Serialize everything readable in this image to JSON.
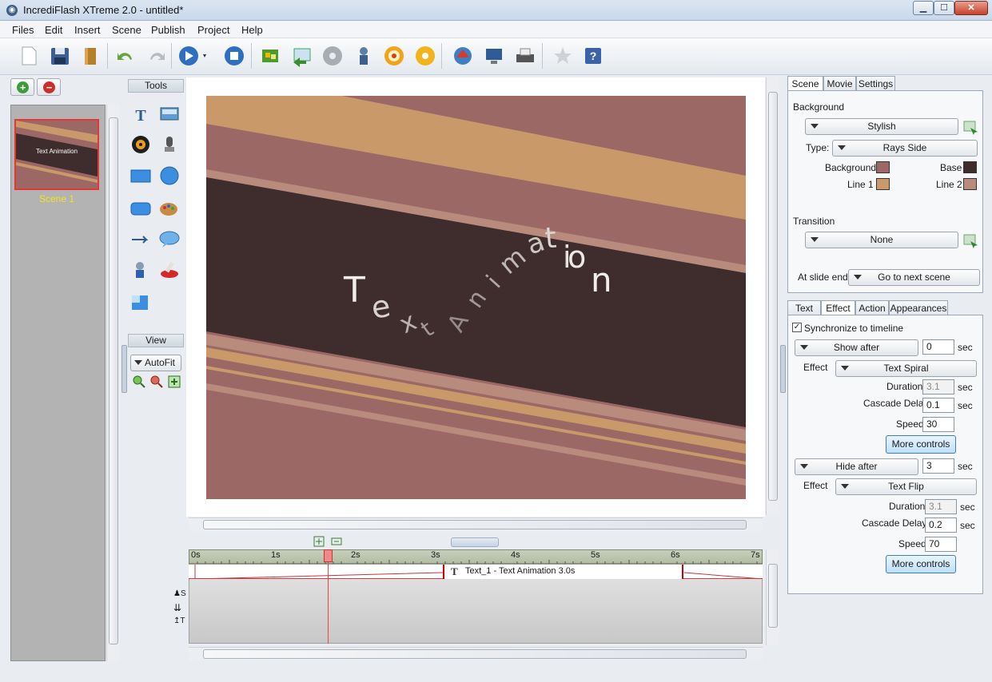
{
  "window": {
    "title": "IncrediFlash XTreme 2.0 - untitled*",
    "controls": {
      "minimize": "▁",
      "maximize": "☐",
      "close": "✕"
    }
  },
  "menu": [
    "Files",
    "Edit",
    "Insert",
    "Scene",
    "Publish",
    "Project",
    "Help"
  ],
  "toolbar": {
    "icons": [
      "new-icon",
      "save-icon",
      "open-icon",
      "undo-icon",
      "redo-icon",
      "play-icon",
      "stop-icon",
      "import-icon",
      "export-icon",
      "cd-icon",
      "wizard-icon",
      "flash-icon",
      "disc-icon",
      "web-icon",
      "screen-icon",
      "print-icon",
      "favorite-icon",
      "help-icon"
    ]
  },
  "scenes": {
    "items": [
      {
        "label": "Scene 1",
        "thumb_text": "Text Animation"
      }
    ]
  },
  "tools": {
    "header": "Tools",
    "view_header": "View",
    "autofit_label": "AutoFit"
  },
  "stage": {
    "text": "Text Animation",
    "colors": {
      "background": "#9b6866",
      "base": "#3f2c2c",
      "line1": "#c9996a",
      "line2": "#b88b7d"
    }
  },
  "timeline": {
    "ticks": [
      "0s",
      "1s",
      "2s",
      "3s",
      "4s",
      "5s",
      "6s",
      "7s"
    ],
    "clip_label": "Text_1 - Text Animation  3.0s",
    "side_labels": {
      "s": "S",
      "t": "T"
    }
  },
  "scene_props": {
    "tabs": [
      "Scene",
      "Movie",
      "Settings"
    ],
    "background_label": "Background",
    "background_value": "Stylish",
    "type_label": "Type:",
    "type_value": "Rays Side",
    "swatches": {
      "background_label": "Background",
      "background_color": "#9b6866",
      "base_label": "Base",
      "base_color": "#3f2c2c",
      "line1_label": "Line 1",
      "line1_color": "#c9996a",
      "line2_label": "Line 2",
      "line2_color": "#b88b7d"
    },
    "transition_label": "Transition",
    "transition_value": "None",
    "slide_end_label": "At slide end:",
    "slide_end_value": "Go to next scene"
  },
  "effect_props": {
    "tabs": [
      "Text",
      "Effect",
      "Action",
      "Appearances"
    ],
    "sync_label": "Synchronize to timeline",
    "show_after_label": "Show after",
    "show_after_value": "0",
    "sec": "sec",
    "effect_label": "Effect",
    "show_effect": "Text Spiral",
    "duration_label": "Duration",
    "show_duration": "3.1",
    "cascade_label": "Cascade Delay",
    "show_cascade": "0.1",
    "speed_label": "Speed",
    "show_speed": "30",
    "more_controls": "More controls",
    "hide_after_label": "Hide after",
    "hide_after_value": "3",
    "hide_effect": "Text Flip",
    "hide_duration": "3.1",
    "hide_cascade": "0.2",
    "hide_speed": "70"
  }
}
